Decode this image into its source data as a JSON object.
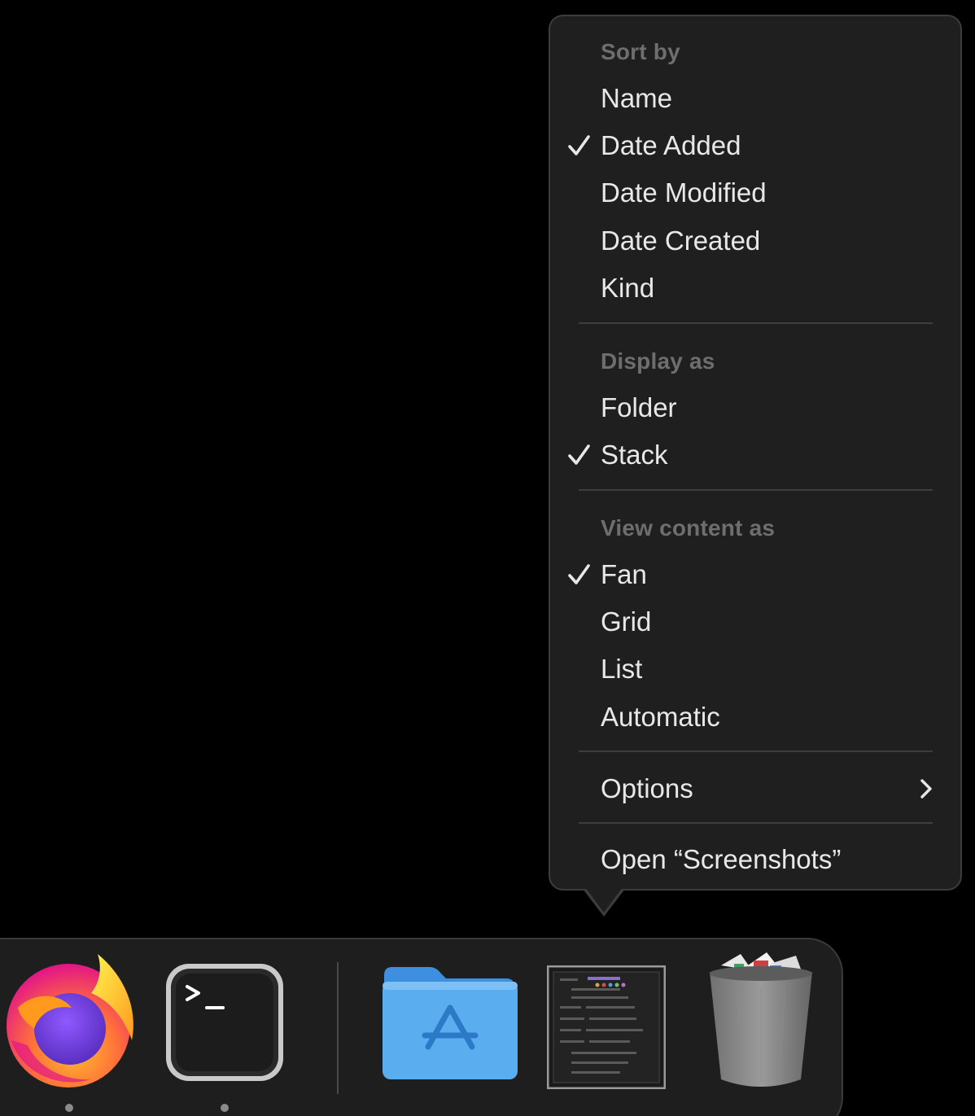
{
  "menu": {
    "sort_header": "Sort by",
    "sort_items": [
      {
        "label": "Name",
        "checked": false
      },
      {
        "label": "Date Added",
        "checked": true
      },
      {
        "label": "Date Modified",
        "checked": false
      },
      {
        "label": "Date Created",
        "checked": false
      },
      {
        "label": "Kind",
        "checked": false
      }
    ],
    "display_header": "Display as",
    "display_items": [
      {
        "label": "Folder",
        "checked": false
      },
      {
        "label": "Stack",
        "checked": true
      }
    ],
    "view_header": "View content as",
    "view_items": [
      {
        "label": "Fan",
        "checked": true
      },
      {
        "label": "Grid",
        "checked": false
      },
      {
        "label": "List",
        "checked": false
      },
      {
        "label": "Automatic",
        "checked": false
      }
    ],
    "options_label": "Options",
    "open_label": "Open “Screenshots”"
  },
  "dock": {
    "apps": [
      {
        "icon": "firefox-icon",
        "running": true
      },
      {
        "icon": "terminal-icon",
        "running": true
      }
    ],
    "stacks": [
      {
        "icon": "applications-folder-icon"
      },
      {
        "icon": "screenshots-stack-icon"
      },
      {
        "icon": "trash-icon"
      }
    ]
  },
  "colors": {
    "menu_bg": "#1f1f1f",
    "menu_text": "#e8e8e8",
    "menu_header": "#6e6e6e",
    "folder_blue": "#5aaef0"
  }
}
